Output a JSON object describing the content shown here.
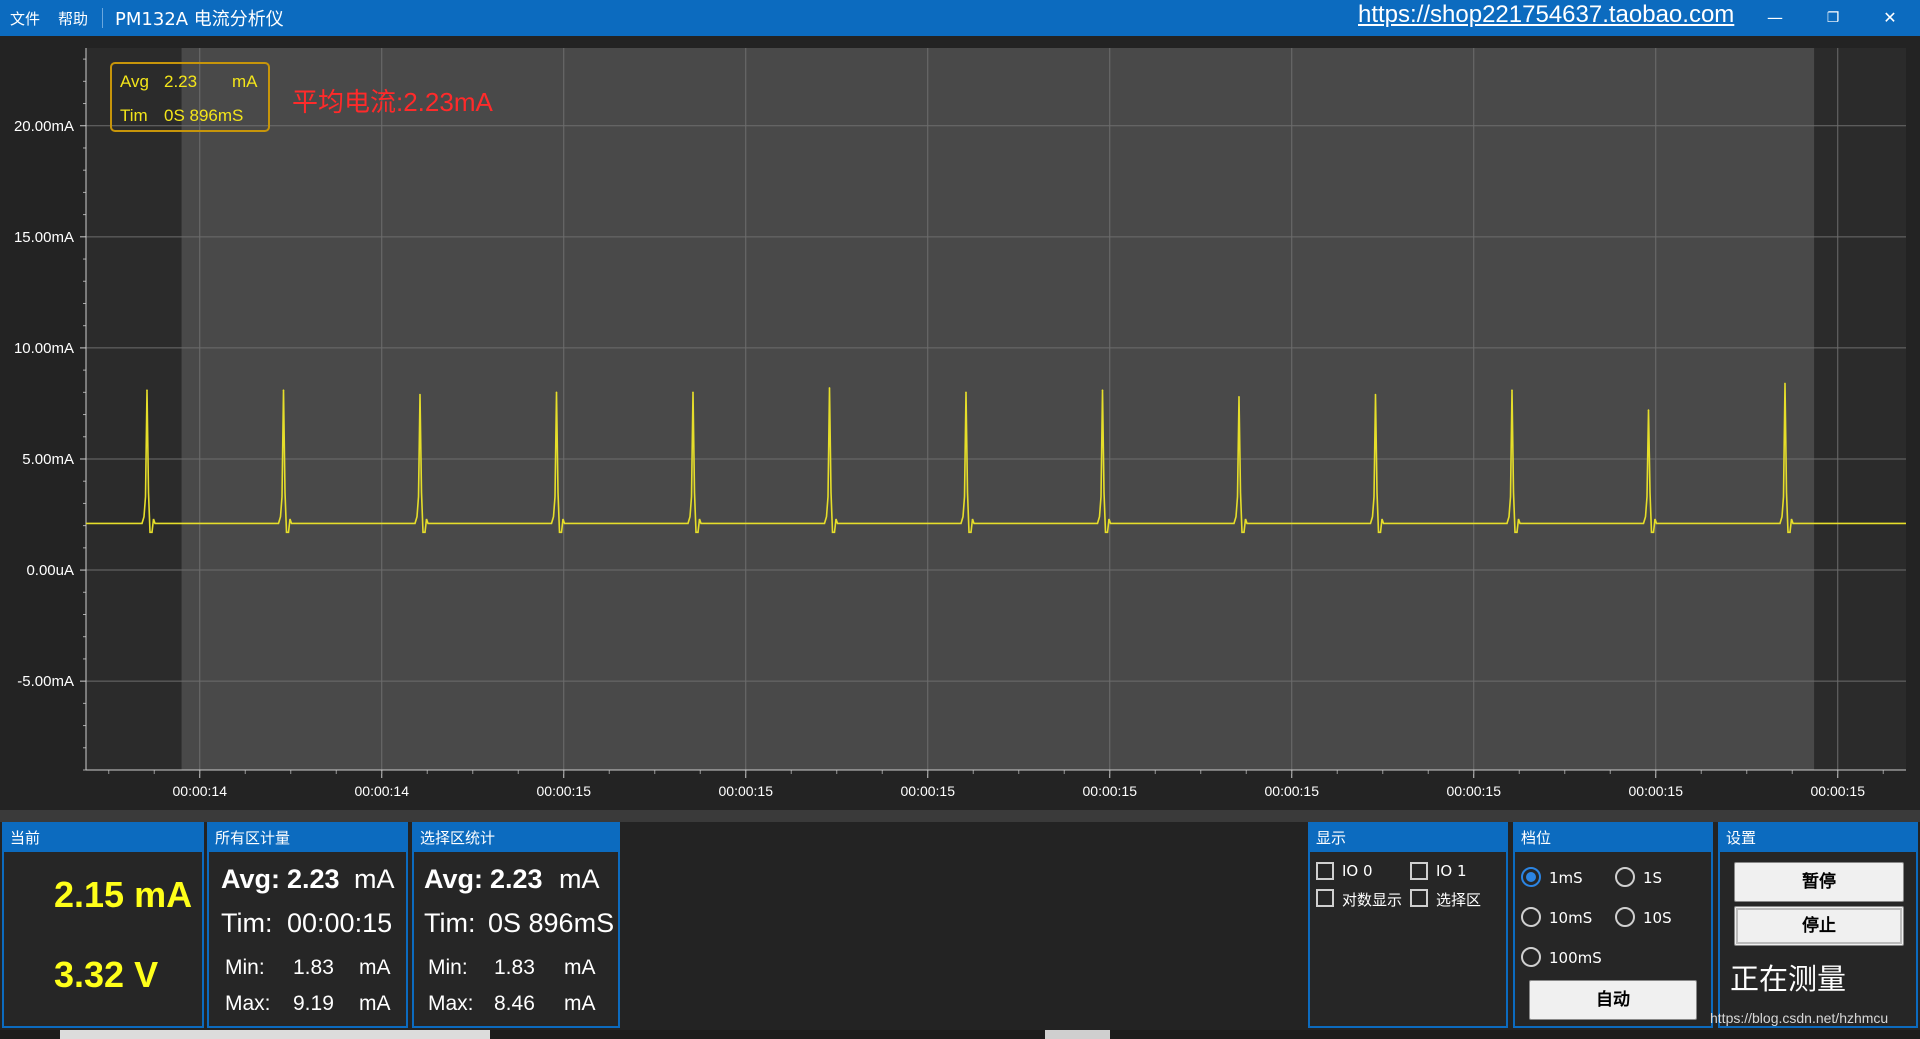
{
  "titlebar": {
    "menu_file": "文件",
    "menu_help": "帮助",
    "app_title": "PM132A 电流分析仪",
    "shop_link": "https://shop221754637.taobao.com",
    "min_glyph": "—",
    "restore_glyph": "❐",
    "close_glyph": "✕"
  },
  "overlay": {
    "avg_label": "Avg",
    "avg_value": "2.23",
    "avg_unit": "mA",
    "tim_label": "Tim",
    "tim_value": "0S 896mS",
    "note": "平均电流:2.23mA"
  },
  "chart_data": {
    "type": "line",
    "y_tick_labels": [
      "20.00mA",
      "15.00mA",
      "10.00mA",
      "5.00mA",
      "0.00uA",
      "-5.00mA"
    ],
    "y_tick_values": [
      20,
      15,
      10,
      5,
      0,
      -5
    ],
    "ylim": [
      -9,
      23.5
    ],
    "x_tick_labels": [
      "00:00:14",
      "00:00:14",
      "00:00:15",
      "00:00:15",
      "00:00:15",
      "00:00:15",
      "00:00:15",
      "00:00:15",
      "00:00:15",
      "00:00:15"
    ],
    "xlim": [
      0,
      1
    ],
    "grid": true,
    "baseline_ma": 2.1,
    "spike_positions": [
      0.0335,
      0.1085,
      0.1835,
      0.2585,
      0.3335,
      0.4085,
      0.4835,
      0.5585,
      0.6335,
      0.7085,
      0.7835,
      0.8585,
      0.9335
    ],
    "spike_peaks_ma": [
      8.1,
      8.1,
      7.9,
      8.0,
      8.0,
      8.2,
      8.0,
      8.1,
      7.8,
      7.9,
      8.1,
      7.2,
      8.4
    ],
    "selection_start": 0.0525,
    "selection_end": 0.9495,
    "colors": {
      "trace": "#e6de2a",
      "selection": "#494949",
      "outside": "#2b2b2b",
      "grid": "#6d6d6d"
    }
  },
  "panels": {
    "current": {
      "title": "当前",
      "current": "2.15 mA",
      "voltage": "3.32 V"
    },
    "all": {
      "title": "所有区计量",
      "avg_label": "Avg:",
      "avg_value": "2.23",
      "avg_unit": "mA",
      "tim_label": "Tim:",
      "tim_value": "00:00:15",
      "min_label": "Min:",
      "min_value": "1.83",
      "min_unit": "mA",
      "max_label": "Max:",
      "max_value": "9.19",
      "max_unit": "mA"
    },
    "selection": {
      "title": "选择区统计",
      "avg_label": "Avg:",
      "avg_value": "2.23",
      "avg_unit": "mA",
      "tim_label": "Tim:",
      "tim_value": "0S 896mS",
      "min_label": "Min:",
      "min_value": "1.83",
      "min_unit": "mA",
      "max_label": "Max:",
      "max_value": "8.46",
      "max_unit": "mA"
    },
    "display": {
      "title": "显示",
      "io0": "IO 0",
      "io1": "IO 1",
      "log": "对数显示",
      "sel": "选择区"
    },
    "range": {
      "title": "档位",
      "r1ms": "1mS",
      "r1s": "1S",
      "r10ms": "10mS",
      "r10s": "10S",
      "r100ms": "100mS",
      "auto": "自动",
      "selected": "1mS"
    },
    "settings": {
      "title": "设置",
      "pause": "暂停",
      "stop": "停止",
      "status": "正在测量"
    }
  },
  "footer": {
    "watermark": "https://blog.csdn.net/hzhmcu"
  }
}
